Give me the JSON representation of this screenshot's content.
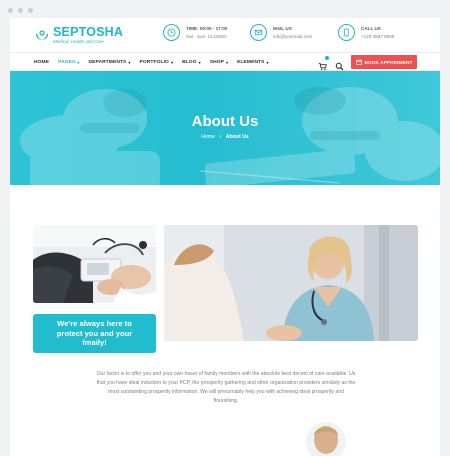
{
  "brand": {
    "name": "SEPTOSHA",
    "tagline": "Medical, Health and Care"
  },
  "header_info": [
    {
      "icon": "clock-icon",
      "title": "TIME: 09:00 - 17:00",
      "detail": "Sat - Sun: CLOSED"
    },
    {
      "icon": "mail-icon",
      "title": "MAIL US",
      "detail": "info@yourmail.com"
    },
    {
      "icon": "phone-icon",
      "title": "CALL US",
      "detail": "+123 4567 8900"
    }
  ],
  "nav": {
    "items": [
      "HOME",
      "PAGES",
      "DEPARTMENTS",
      "PORTFOLIO",
      "BLOG",
      "SHOP",
      "ELEMENTS"
    ],
    "active_index": 1,
    "appointment_label": "BOOK APPOINMENT"
  },
  "hero": {
    "title": "About Us",
    "breadcrumb_home": "Home",
    "breadcrumb_sep": "›",
    "breadcrumb_current": "About Us"
  },
  "cta": {
    "text": "We're always here to protect you and your fmaily!"
  },
  "about": {
    "paragraph": "Our factor is to offer you and your own hoser of family members with the absolute best decent of care available. Us that you have ideal induction to your PCP, the prosperity gathering and other organization providers similarly as the most outstanding prosperity information. We will presumably help you with achieving ideal prosperity and flourishing."
  },
  "colors": {
    "accent": "#1fb6c9",
    "hero_bg": "#2ec4d6",
    "appointment_bg": "#f0504f",
    "text_muted": "#7c8088"
  }
}
